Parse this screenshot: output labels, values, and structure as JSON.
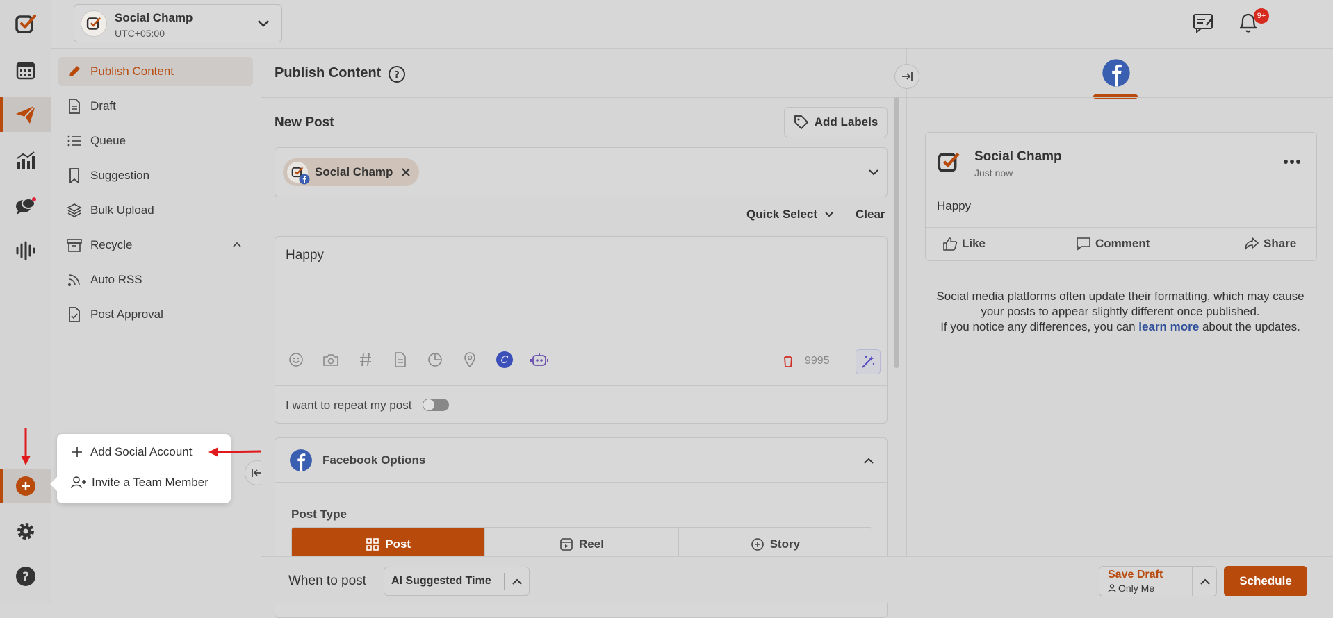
{
  "topbar": {
    "account_name": "Social Champ",
    "timezone": "UTC+05:00",
    "notification_badge": "9+"
  },
  "rail": {
    "items": [
      "logo-icon",
      "calendar-icon",
      "publish-icon",
      "analytics-icon",
      "engage-icon",
      "listening-icon"
    ],
    "bottom": [
      "add-icon",
      "settings-icon",
      "help-icon"
    ]
  },
  "sidebar": {
    "items": [
      {
        "label": "Publish Content",
        "icon": "pencil-icon"
      },
      {
        "label": "Draft",
        "icon": "document-icon"
      },
      {
        "label": "Queue",
        "icon": "list-icon"
      },
      {
        "label": "Suggestion",
        "icon": "bookmark-icon"
      },
      {
        "label": "Bulk Upload",
        "icon": "layers-icon"
      },
      {
        "label": "Recycle",
        "icon": "archive-icon"
      },
      {
        "label": "Auto RSS",
        "icon": "rss-icon"
      },
      {
        "label": "Post Approval",
        "icon": "approval-icon"
      }
    ]
  },
  "popup": {
    "add_account": "Add Social Account",
    "invite_member": "Invite a Team Member"
  },
  "composer": {
    "header": "Publish Content",
    "new_post": "New Post",
    "add_labels": "Add Labels",
    "selected_account": "Social Champ",
    "quick_select": "Quick Select",
    "clear": "Clear",
    "post_text": "Happy",
    "char_count": "9995",
    "repeat_label": "I want to repeat my post",
    "fb_options": "Facebook Options",
    "post_type_label": "Post Type",
    "post_types": [
      "Post",
      "Reel",
      "Story"
    ]
  },
  "bottom": {
    "when_label": "When to post",
    "time_option": "AI Suggested Time",
    "save_draft": "Save Draft",
    "only_me": "Only Me",
    "schedule": "Schedule"
  },
  "preview": {
    "account": "Social Champ",
    "time": "Just now",
    "text": "Happy",
    "like": "Like",
    "comment": "Comment",
    "share": "Share",
    "note_line1": "Social media platforms often update their formatting, which may cause",
    "note_line2": "your posts to appear slightly different once published.",
    "note_line3a": "If you notice any differences, you can",
    "note_link": "learn more",
    "note_line3b": "about the updates."
  },
  "colors": {
    "accent": "#b84a0c",
    "facebook": "#3b5fb0",
    "link": "#2f4f9a"
  }
}
